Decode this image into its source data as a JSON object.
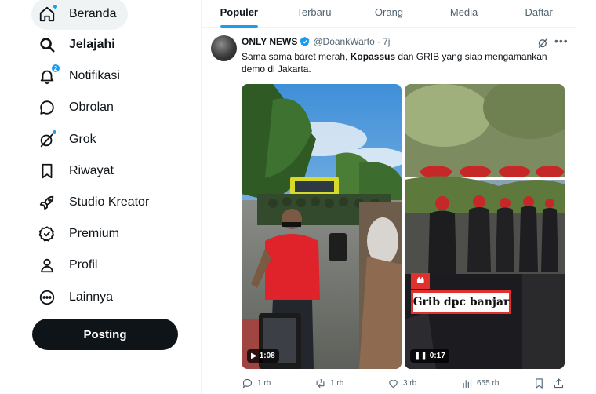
{
  "sidebar": {
    "items": [
      {
        "label": "Beranda",
        "icon": "home-icon"
      },
      {
        "label": "Jelajahi",
        "icon": "search-icon"
      },
      {
        "label": "Notifikasi",
        "icon": "bell-icon",
        "badge": "2"
      },
      {
        "label": "Obrolan",
        "icon": "chat-icon"
      },
      {
        "label": "Grok",
        "icon": "grok-icon"
      },
      {
        "label": "Riwayat",
        "icon": "bookmark-icon"
      },
      {
        "label": "Studio Kreator",
        "icon": "rocket-icon"
      },
      {
        "label": "Premium",
        "icon": "verified-badge-icon"
      },
      {
        "label": "Profil",
        "icon": "person-icon"
      },
      {
        "label": "Lainnya",
        "icon": "more-circle-icon"
      }
    ],
    "post_label": "Posting"
  },
  "tabs": [
    {
      "label": "Populer",
      "active": true
    },
    {
      "label": "Terbaru"
    },
    {
      "label": "Orang"
    },
    {
      "label": "Media"
    },
    {
      "label": "Daftar"
    }
  ],
  "tweet": {
    "name": "ONLY NEWS",
    "handle": "@DoankWarto",
    "time": "· 7j",
    "text_1": "Sama sama baret merah, ",
    "text_bold": "Kopassus",
    "text_2": " dan GRIB yang siap mengamankan demo di Jakarta.",
    "media": [
      {
        "duration": "1:08",
        "state": "play"
      },
      {
        "duration": "0:17",
        "state": "pause",
        "caption": "Grib dpc banjar"
      }
    ],
    "stats": {
      "replies": "1 rb",
      "reposts": "1 rb",
      "likes": "3 rb",
      "views": "655 rb"
    }
  },
  "colors": {
    "accent": "#1d9bf0",
    "text": "#0f1419",
    "muted": "#536471",
    "post_button": "#0f1419",
    "caption_red": "#e0312e"
  }
}
